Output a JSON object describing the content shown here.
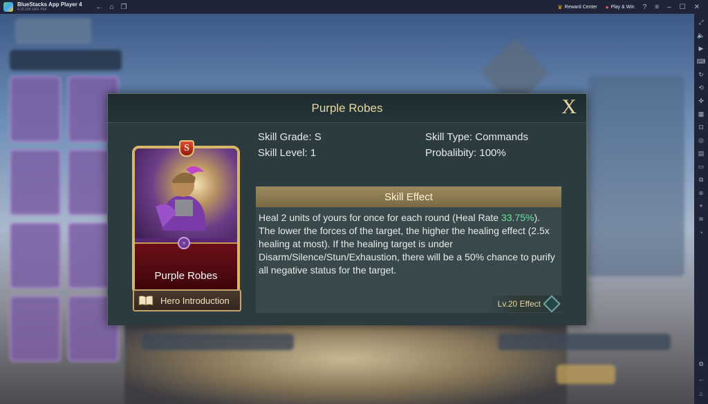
{
  "window": {
    "app_title": "BlueStacks App Player 4",
    "app_version": "4.32.200.1001 P64",
    "reward_center_label": "Reward Center",
    "play_win_label": "Play & Win"
  },
  "modal": {
    "title": "Purple Robes",
    "close_label": "X",
    "card": {
      "grade_letter": "S",
      "name": "Purple Robes"
    },
    "hero_intro_label": "Hero Introduction",
    "skill": {
      "grade": "Skill Grade: S",
      "level": "Skill Level: 1",
      "type": "Skill Type: Commands",
      "probability": "Probalibity: 100%"
    },
    "effect": {
      "header": "Skill Effect",
      "text_before": "Heal 2 units of yours for once for each round (Heal Rate ",
      "highlight": "33.75%",
      "text_after": "). The lower the forces of the target, the higher the healing effect (2.5x healing at most). If the healing target is under Disarm/Silence/Stun/Exhaustion, there will be a 50% chance to purify all negative status for the target."
    },
    "lv_effect_label": "Lv.20 Effect"
  },
  "colors": {
    "title_gold": "#e8d8a2",
    "highlight_green": "#6fe3a3",
    "effect_header": "#9c8a5e",
    "modal_bg": "#28383d"
  }
}
